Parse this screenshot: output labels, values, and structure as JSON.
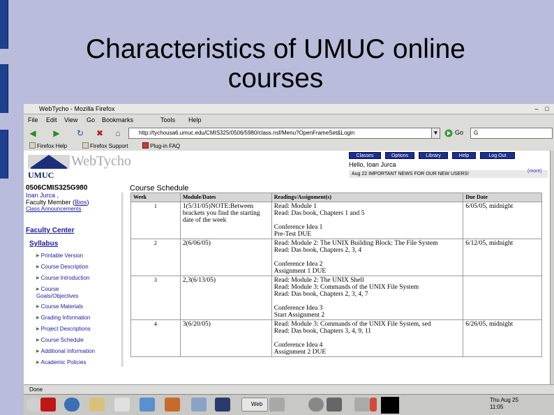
{
  "slide": {
    "title": "Characteristics of UMUC online\ncourses"
  },
  "browser": {
    "window_title": "WebTycho - Mozilla Firefox",
    "menu": [
      "File",
      "Edit",
      "View",
      "Go",
      "Bookmarks",
      "Tools",
      "Help"
    ],
    "url": "http://tychousa6.umuc.edu/CMIS325/0506/5980/class.nsf/Menu?OpenFrameSet&Login",
    "go_label": "Go",
    "search_value": "G",
    "bookmarks": [
      "Firefox Help",
      "Firefox Support",
      "Plug-in FAQ"
    ],
    "status_text": "Done"
  },
  "site": {
    "logo_umuc": "UMUC",
    "logo_webtycho": "WebTycho",
    "nav_buttons": [
      "Classes",
      "Options",
      "Library",
      "Help",
      "Log Out"
    ],
    "welcome": "Hello, Ioan Jurca",
    "news": "Aug 22 IMPORTANT NEWS FOR OUR NEW USERS!",
    "news_more": "(more)"
  },
  "sidebar": {
    "course_code": "0506CMIS325G980",
    "instructor": "Ioan Jurca ,",
    "role_prefix": "Faculty Member (",
    "bios": "Bios",
    "role_suffix": ")",
    "class_announcements": "Class Announcements",
    "faculty_center": "Faculty Center",
    "syllabus": "Syllabus",
    "items": [
      "Printable Version",
      "Course Description",
      "Course Introduction",
      "Course Goals/Objectives",
      "Course Materials",
      "Grading Information",
      "Project Descriptions",
      "Course Schedule",
      "Additional Information",
      "Academic Policies"
    ]
  },
  "schedule": {
    "heading": "Course Schedule",
    "headers": [
      "Week",
      "Module/Dates",
      "Readings/Assignment(s)",
      "Due Date"
    ],
    "rows": [
      {
        "week": "1",
        "dates": "1(5/31/05)NOTE:Between brackets you find the starting date of the week",
        "readings": [
          "Read: Module 1",
          "Read: Das book, Chapters 1 and 5",
          "",
          "Conference Idea 1",
          "Pre-Test DUE"
        ],
        "due": "6/05/05, midnight"
      },
      {
        "week": "2",
        "dates": "2(6/06/05)",
        "readings": [
          "Read: Module 2: The UNIX Building Block: The File System",
          "Read: Das book, Chapters 2, 3, 4",
          "",
          "Conference Idea 2",
          "Assignment 1 DUE"
        ],
        "due": "6/12/05, midnight"
      },
      {
        "week": "3",
        "dates": "2,3(6/13/05)",
        "readings": [
          "Read: Module 2: The UNIX Shell",
          "Read: Module 3: Commands of the UNIX File System",
          "Read: Das book, Chapters 2, 3, 4, 7",
          "",
          "Conference Idea 3",
          "Start Assignment 2"
        ],
        "due": ""
      },
      {
        "week": "4",
        "dates": "3(6/20/05)",
        "readings": [
          "Read: Module 3: Commands of the UNIX File System, sed",
          "Read: Das book, Chapters 3, 4, 9, 11",
          "",
          "Conference Idea 4",
          "Assignment 2 DUE"
        ],
        "due": "6/26/05, midnight"
      }
    ]
  },
  "taskbar": {
    "app": "Web",
    "clock_date": "Thu Aug 25",
    "clock_time": "11:05"
  }
}
